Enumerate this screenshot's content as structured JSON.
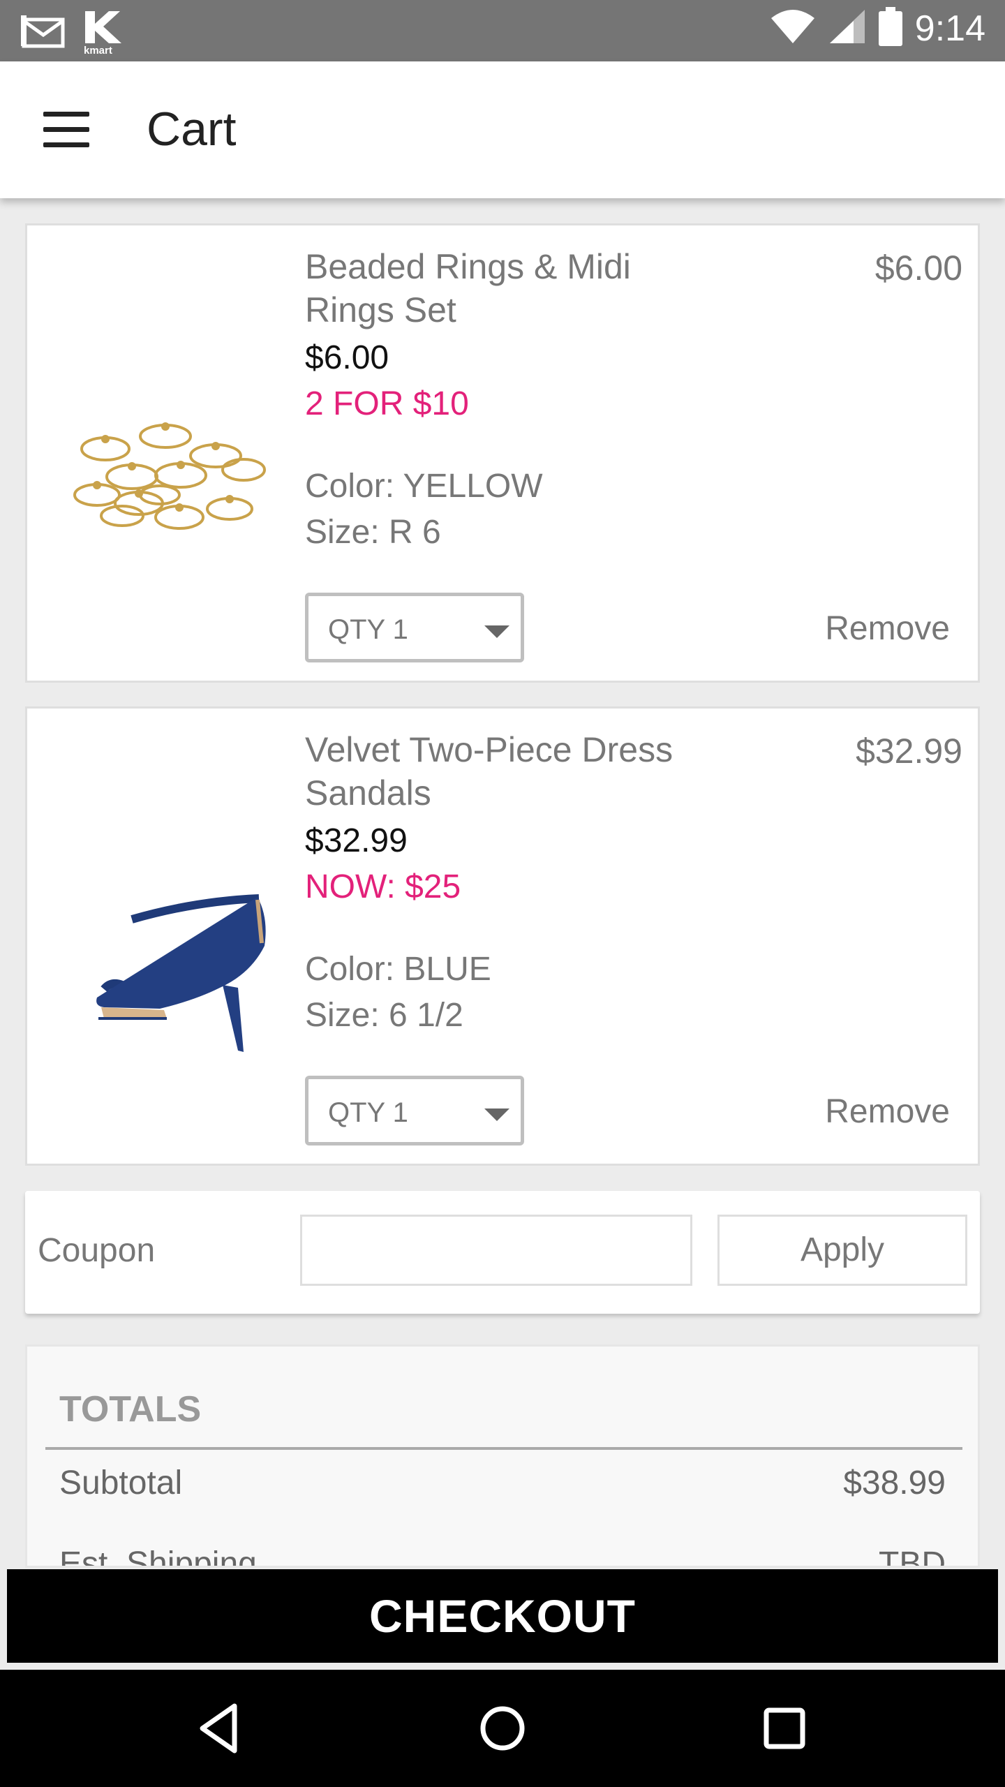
{
  "status_bar": {
    "time": "9:14",
    "left_icons": [
      "gmail-icon",
      "kmart-icon"
    ],
    "kmart_label": "kmart",
    "right_icons": [
      "wifi-icon",
      "signal-icon",
      "battery-icon"
    ]
  },
  "app_bar": {
    "title": "Cart",
    "menu_icon": "hamburger-menu-icon"
  },
  "cart": {
    "items": [
      {
        "name": "Beaded Rings & Midi Rings Set",
        "price": "$6.00",
        "promo": "2 FOR $10",
        "color": "Color: YELLOW",
        "size": "Size: R 6",
        "qty": "QTY 1",
        "line_total": "$6.00",
        "remove": "Remove",
        "image": "rings-set-image"
      },
      {
        "name": "Velvet Two-Piece Dress Sandals",
        "price": "$32.99",
        "promo": "NOW: $25",
        "color": "Color: BLUE",
        "size": "Size:  6 1/2",
        "qty": "QTY 1",
        "line_total": "$32.99",
        "remove": "Remove",
        "image": "blue-sandal-image"
      }
    ]
  },
  "coupon": {
    "label": "Coupon",
    "input_value": "",
    "apply_label": "Apply"
  },
  "totals": {
    "title": "TOTALS",
    "subtotal_label": "Subtotal",
    "subtotal_value": "$38.99",
    "shipping_label": "Est. Shipping",
    "shipping_value": "TBD"
  },
  "checkout": {
    "label": "CHECKOUT"
  },
  "nav_bar": {
    "icons": [
      "back-icon",
      "home-icon",
      "recents-icon"
    ]
  },
  "colors": {
    "promo": "#e3217a",
    "status_bar": "#757575",
    "checkout_bg": "#000000"
  }
}
